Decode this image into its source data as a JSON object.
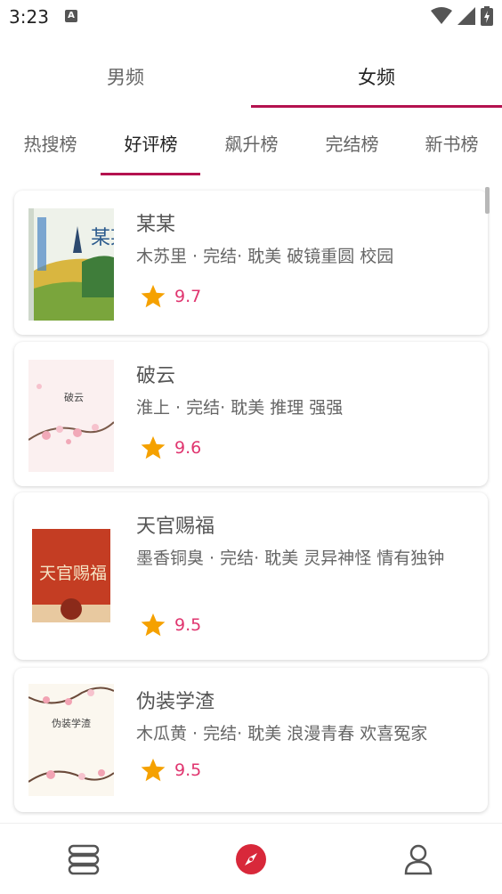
{
  "status_bar": {
    "time": "3:23",
    "notif_letter": "A"
  },
  "top_tabs": [
    {
      "label": "男频"
    },
    {
      "label": "女频"
    }
  ],
  "sub_tabs": [
    {
      "label": "热搜榜"
    },
    {
      "label": "好评榜"
    },
    {
      "label": "飙升榜"
    },
    {
      "label": "完结榜"
    },
    {
      "label": "新书榜"
    }
  ],
  "books": [
    {
      "title": "某某",
      "meta": "木苏里 · 完结· 耽美 破镜重圆 校园",
      "rating": "9.7",
      "cover_title": "某某"
    },
    {
      "title": "破云",
      "meta": "淮上 · 完结· 耽美 推理 强强",
      "rating": "9.6",
      "cover_title": "破云"
    },
    {
      "title": "天官赐福",
      "meta": "墨香铜臭 · 完结· 耽美 灵异神怪 情有独钟",
      "rating": "9.5",
      "cover_title": "天官赐福"
    },
    {
      "title": "伪装学渣",
      "meta": "木瓜黄 · 完结· 耽美 浪漫青春 欢喜冤家",
      "rating": "9.5",
      "cover_title": "伪装学渣"
    }
  ],
  "colors": {
    "accent": "#b4124f",
    "rating": "#e0356f",
    "star": "#f5a100",
    "compass": "#d8283a"
  },
  "bottom_nav": [
    {
      "icon": "bookshelf-icon"
    },
    {
      "icon": "compass-icon"
    },
    {
      "icon": "profile-icon"
    }
  ]
}
